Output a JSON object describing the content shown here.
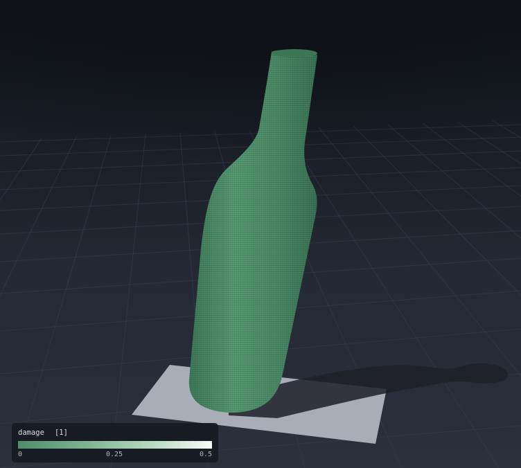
{
  "legend": {
    "field_name": "damage",
    "component": "[1]",
    "min_label": "0",
    "mid_label": "0.25",
    "max_label": "0.5",
    "colormap": [
      "#4f8e68",
      "#86b995",
      "#c4e0cb",
      "#f7fbf8"
    ]
  },
  "scene": {
    "object_color": "#4a8a67",
    "plate_color": "#a9adb8",
    "background_color": "#252935",
    "grid_color": "#3a4050"
  }
}
